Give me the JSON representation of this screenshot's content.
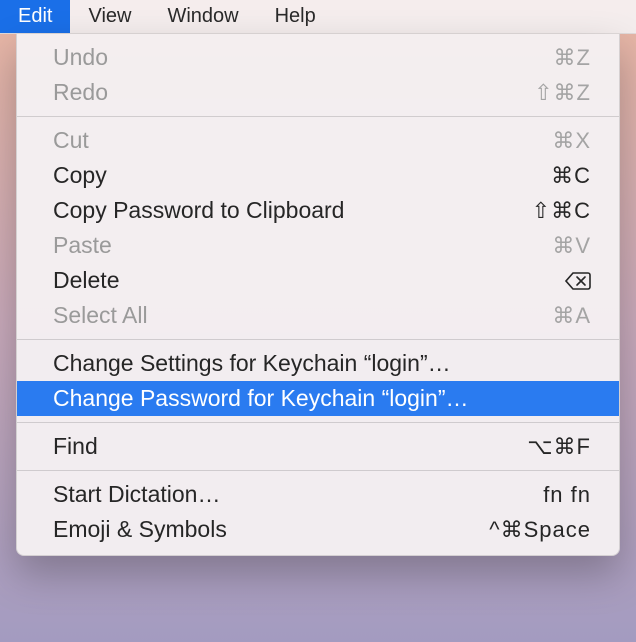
{
  "menubar": {
    "items": [
      {
        "label": "Edit",
        "active": true
      },
      {
        "label": "View",
        "active": false
      },
      {
        "label": "Window",
        "active": false
      },
      {
        "label": "Help",
        "active": false
      }
    ]
  },
  "edit_menu": {
    "groups": [
      [
        {
          "id": "undo",
          "label": "Undo",
          "shortcut": "⌘Z",
          "enabled": false
        },
        {
          "id": "redo",
          "label": "Redo",
          "shortcut": "⇧⌘Z",
          "enabled": false
        }
      ],
      [
        {
          "id": "cut",
          "label": "Cut",
          "shortcut": "⌘X",
          "enabled": false
        },
        {
          "id": "copy",
          "label": "Copy",
          "shortcut": "⌘C",
          "enabled": true
        },
        {
          "id": "copy-password",
          "label": "Copy Password to Clipboard",
          "shortcut": "⇧⌘C",
          "enabled": true
        },
        {
          "id": "paste",
          "label": "Paste",
          "shortcut": "⌘V",
          "enabled": false
        },
        {
          "id": "delete",
          "label": "Delete",
          "shortcut_icon": "backspace",
          "enabled": true
        },
        {
          "id": "select-all",
          "label": "Select All",
          "shortcut": "⌘A",
          "enabled": false
        }
      ],
      [
        {
          "id": "change-settings",
          "label": "Change Settings for Keychain “login”…",
          "shortcut": "",
          "enabled": true
        },
        {
          "id": "change-password",
          "label": "Change Password for Keychain “login”…",
          "shortcut": "",
          "enabled": true,
          "highlight": true
        }
      ],
      [
        {
          "id": "find",
          "label": "Find",
          "shortcut": "⌥⌘F",
          "enabled": true
        }
      ],
      [
        {
          "id": "start-dictation",
          "label": "Start Dictation…",
          "shortcut": "fn fn",
          "enabled": true
        },
        {
          "id": "emoji-symbols",
          "label": "Emoji & Symbols",
          "shortcut": "^⌘Space",
          "enabled": true
        }
      ]
    ]
  }
}
